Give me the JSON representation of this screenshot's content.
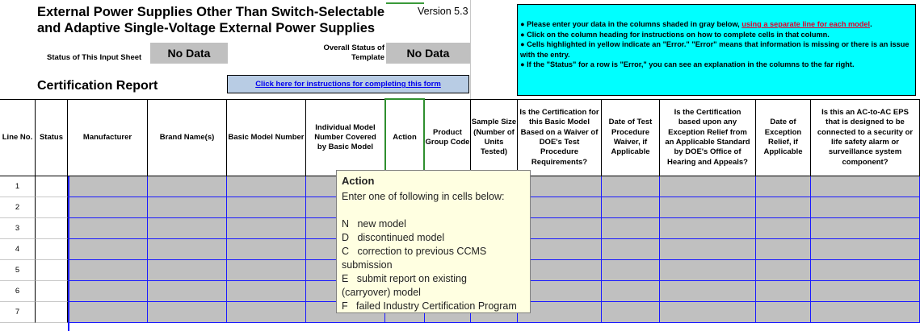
{
  "header": {
    "title_line1": "External Power Supplies Other Than Switch-Selectable",
    "title_line2": "and Adaptive Single-Voltage External Power Supplies",
    "version": "Version 5.3",
    "status_label": "Status of This Input Sheet",
    "status_value": "No Data",
    "overall_label_line1": "Overall Status of",
    "overall_label_line2": "Template",
    "overall_value": "No Data",
    "cert_title": "Certification Report",
    "instructions_link": "Click here for instructions for completing this form"
  },
  "notes": {
    "line1_prefix": "● Please enter your data in the columns shaded in gray below, ",
    "line1_link": "using a separate line for each model",
    "line1_suffix": ".",
    "line2": "● Click on the column heading for instructions on how to complete cells in that column.",
    "line3": "● Cells highlighted in yellow indicate an \"Error.\"  \"Error\" means that information is missing or there is an issue with the entry.",
    "line4": "● If the \"Status\" for a row is \"Error,\" you can see an explanation in the columns to the far right."
  },
  "columns": [
    "Line No.",
    "Status",
    "Manufacturer",
    "Brand Name(s)",
    "Basic Model Number",
    "Individual Model Number Covered by Basic Model",
    "Action",
    "Product Group Code",
    "Sample Size (Number of Units Tested)",
    "Is the Certification for this Basic Model Based on a Waiver of DOE's Test Procedure Requirements?",
    "Date of Test Procedure Waiver, if Applicable",
    "Is the Certification based upon any Exception Relief from an Applicable Standard by DOE's Office of Hearing and Appeals?",
    "Date of Exception Relief, if Applicable",
    "Is this an AC-to-AC EPS that is designed to be connected to a security or life safety alarm or surveillance system component?"
  ],
  "rows": [
    "1",
    "2",
    "3",
    "4",
    "5",
    "6",
    "7"
  ],
  "tooltip": {
    "title": "Action",
    "intro": "Enter one of following in cells below:",
    "lines": [
      "N   new model",
      "D   discontinued model",
      "C   correction to previous CCMS",
      "submission",
      "E   submit report on existing",
      "(carryover) model",
      "F   failed Industry Certification Program"
    ]
  }
}
